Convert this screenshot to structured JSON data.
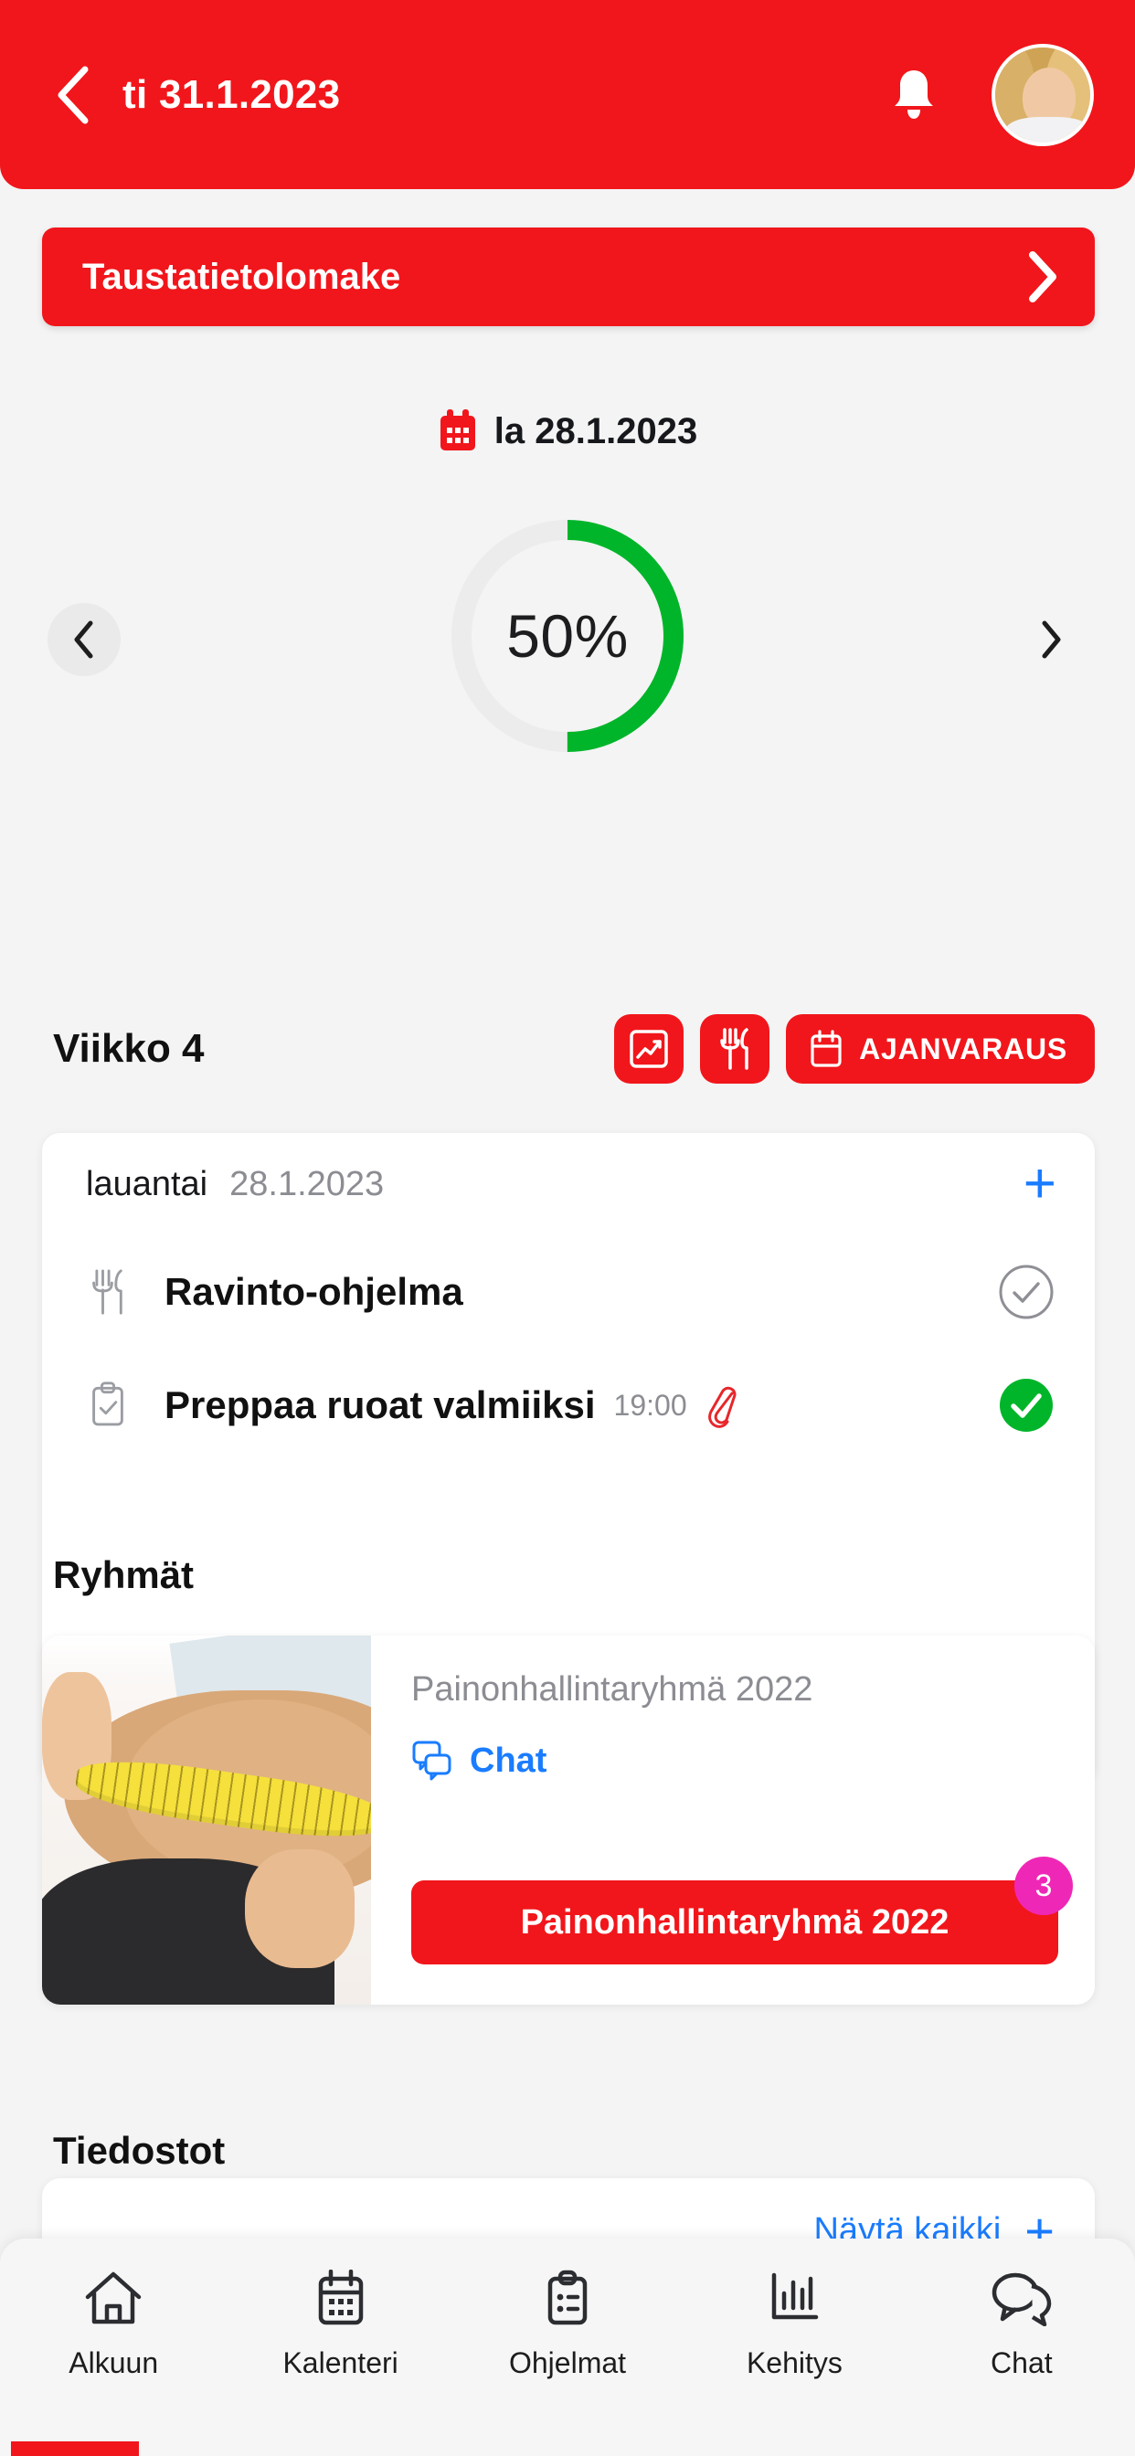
{
  "header": {
    "back_icon": "chevron-left-icon",
    "title": "ti 31.1.2023",
    "bell_icon": "bell-icon",
    "avatar": "user-avatar"
  },
  "background_form": {
    "label": "Taustatietolomake",
    "chevron_icon": "chevron-right-icon"
  },
  "selected_date": {
    "calendar_icon": "calendar-icon",
    "text": "la 28.1.2023"
  },
  "progress": {
    "percent_label": "50%",
    "percent_value": 50,
    "track_color": "#ececec",
    "fill_color": "#00b52a",
    "prev_icon": "chevron-left-icon",
    "next_icon": "chevron-right-icon"
  },
  "week": {
    "label": "Viikko 4",
    "actions": [
      {
        "name": "progress-chart-button",
        "icon": "chart-line-icon",
        "label": ""
      },
      {
        "name": "nutrition-button",
        "icon": "cutlery-icon",
        "label": ""
      },
      {
        "name": "booking-button",
        "icon": "calendar-icon",
        "label": "AJANVARAUS"
      }
    ]
  },
  "task_card": {
    "day_label": "lauantai",
    "date_label": "28.1.2023",
    "add_icon": "plus-icon",
    "rows": [
      {
        "icon": "cutlery-icon",
        "title": "Ravinto-ohjelma",
        "time": "",
        "attachment": false,
        "completed": false
      },
      {
        "icon": "clipboard-check-icon",
        "title": "Preppaa ruoat valmiiksi",
        "time": "19:00",
        "attachment": true,
        "completed": true
      }
    ]
  },
  "groups_section": {
    "title": "Ryhmät",
    "card": {
      "image_alt": "waist-measurement-photo",
      "title": "Painonhallintaryhmä 2022",
      "chat_icon": "chat-bubbles-icon",
      "chat_label": "Chat",
      "button_label": "Painonhallintaryhmä 2022",
      "badge_count": "3",
      "badge_color": "#ef27b6"
    }
  },
  "files_section": {
    "title": "Tiedostot",
    "show_all_label": "Näytä kaikki",
    "add_icon": "plus-icon"
  },
  "bottom_nav": {
    "items": [
      {
        "icon": "home-icon",
        "label": "Alkuun"
      },
      {
        "icon": "calendar-icon",
        "label": "Kalenteri"
      },
      {
        "icon": "clipboard-icon",
        "label": "Ohjelmat"
      },
      {
        "icon": "bar-chart-icon",
        "label": "Kehitys"
      },
      {
        "icon": "chat-bubbles-icon",
        "label": "Chat"
      }
    ]
  },
  "theme": {
    "brand_red": "#f1161b",
    "accent_blue": "#1a7cff",
    "success_green": "#00b52a",
    "badge_pink": "#ef27b6"
  }
}
